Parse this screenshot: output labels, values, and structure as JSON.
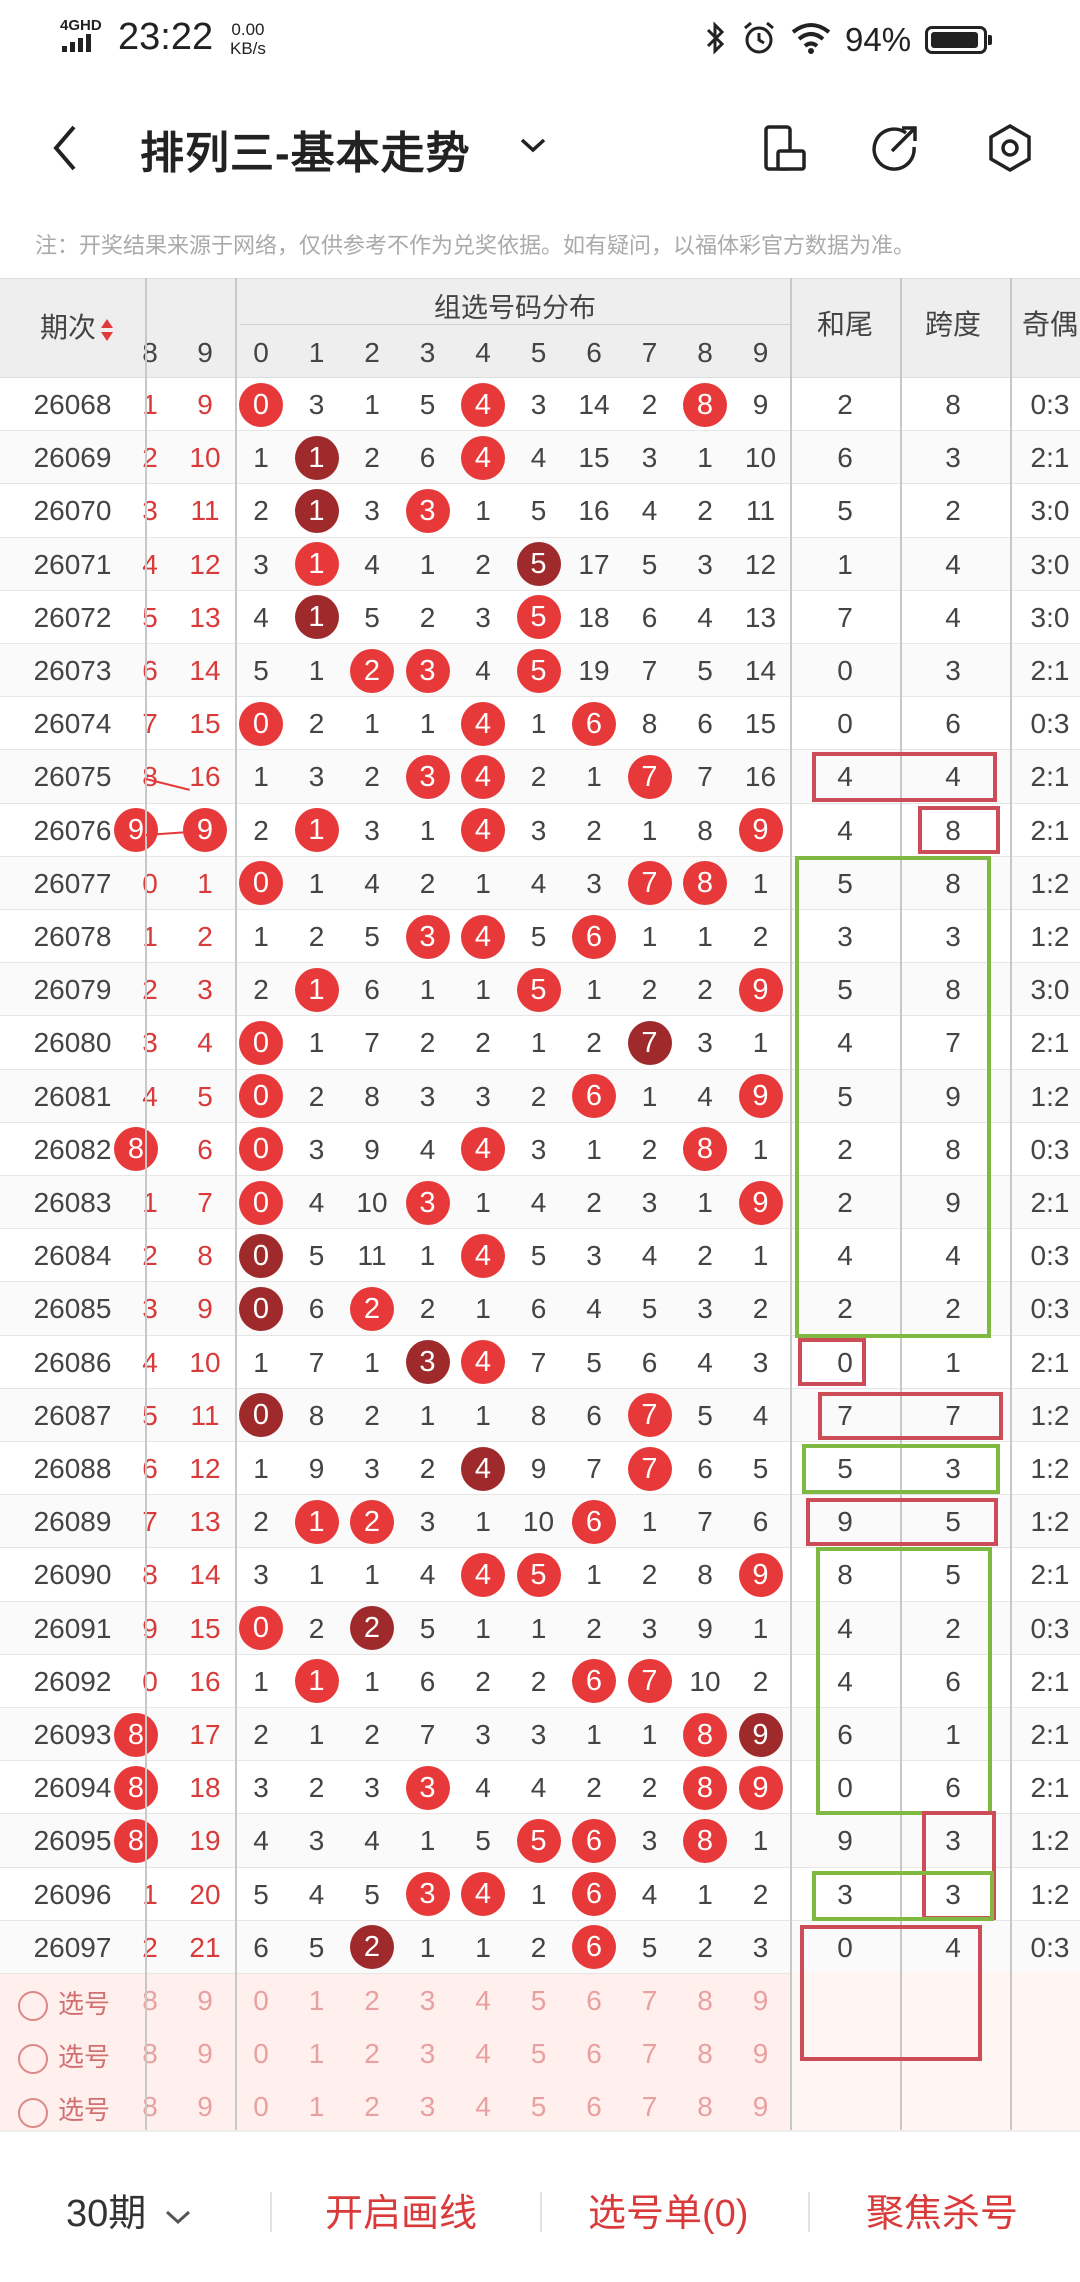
{
  "status_bar": {
    "network": "4GHD",
    "time": "23:22",
    "speed_value": "0.00",
    "speed_unit": "KB/s",
    "battery": "94%",
    "battery_level": 0.94
  },
  "header": {
    "title": "排列三-基本走势",
    "icons": [
      "back-icon",
      "chevron-down-icon",
      "phone-rotate-icon",
      "share-icon",
      "settings-icon"
    ]
  },
  "notice": "注：开奖结果来源于网络，仅供参考不作为兑奖依据。如有疑问，以福体彩官方数据为准。",
  "table": {
    "col_period": "期次",
    "group_header": "组选号码分布",
    "col_sum_tail": "和尾",
    "col_span": "跨度",
    "col_odd_even": "奇偶",
    "left_partial_headers": [
      "8",
      "9"
    ],
    "digits": [
      "0",
      "1",
      "2",
      "3",
      "4",
      "5",
      "6",
      "7",
      "8",
      "9"
    ],
    "rows": [
      {
        "p": "26068",
        "l": [
          "1",
          "9"
        ],
        "d": [
          "0",
          "3",
          "1",
          "5",
          "4",
          "3",
          "14",
          "2",
          "8",
          "9"
        ],
        "hit": [
          0,
          4,
          8
        ],
        "dark": [],
        "s": "2",
        "k": "8",
        "o": "0:3"
      },
      {
        "p": "26069",
        "l": [
          "2",
          "10"
        ],
        "d": [
          "1",
          "1",
          "2",
          "6",
          "4",
          "4",
          "15",
          "3",
          "1",
          "10"
        ],
        "hit": [
          1,
          4
        ],
        "dark": [
          1
        ],
        "s": "6",
        "k": "3",
        "o": "2:1"
      },
      {
        "p": "26070",
        "l": [
          "3",
          "11"
        ],
        "d": [
          "2",
          "1",
          "3",
          "3",
          "1",
          "5",
          "16",
          "4",
          "2",
          "11"
        ],
        "hit": [
          1,
          3
        ],
        "dark": [
          1
        ],
        "s": "5",
        "k": "2",
        "o": "3:0"
      },
      {
        "p": "26071",
        "l": [
          "4",
          "12"
        ],
        "d": [
          "3",
          "1",
          "4",
          "1",
          "2",
          "5",
          "17",
          "5",
          "3",
          "12"
        ],
        "hit": [
          1,
          5
        ],
        "dark": [
          5
        ],
        "s": "1",
        "k": "4",
        "o": "3:0"
      },
      {
        "p": "26072",
        "l": [
          "5",
          "13"
        ],
        "d": [
          "4",
          "1",
          "5",
          "2",
          "3",
          "5",
          "18",
          "6",
          "4",
          "13"
        ],
        "hit": [
          1,
          5
        ],
        "dark": [
          1
        ],
        "s": "7",
        "k": "4",
        "o": "3:0"
      },
      {
        "p": "26073",
        "l": [
          "6",
          "14"
        ],
        "d": [
          "5",
          "1",
          "2",
          "3",
          "4",
          "5",
          "19",
          "7",
          "5",
          "14"
        ],
        "hit": [
          2,
          3,
          5
        ],
        "dark": [],
        "s": "0",
        "k": "3",
        "o": "2:1"
      },
      {
        "p": "26074",
        "l": [
          "7",
          "15"
        ],
        "d": [
          "0",
          "2",
          "1",
          "1",
          "4",
          "1",
          "6",
          "8",
          "6",
          "15"
        ],
        "hit": [
          0,
          4,
          6
        ],
        "dark": [],
        "s": "0",
        "k": "6",
        "o": "0:3"
      },
      {
        "p": "26075",
        "l": [
          "8",
          "16"
        ],
        "d": [
          "1",
          "3",
          "2",
          "3",
          "4",
          "2",
          "1",
          "7",
          "7",
          "16"
        ],
        "hit": [
          3,
          4,
          7
        ],
        "dark": [],
        "s": "4",
        "k": "4",
        "o": "2:1"
      },
      {
        "p": "26076",
        "l": [
          "9",
          "9"
        ],
        "d": [
          "2",
          "1",
          "3",
          "1",
          "4",
          "3",
          "2",
          "1",
          "8",
          "9"
        ],
        "hit": [
          1,
          4,
          9
        ],
        "dark": [],
        "s": "4",
        "k": "8",
        "o": "2:1",
        "lball": true
      },
      {
        "p": "26077",
        "l": [
          "0",
          "1"
        ],
        "d": [
          "0",
          "1",
          "4",
          "2",
          "1",
          "4",
          "3",
          "7",
          "8",
          "1"
        ],
        "hit": [
          0,
          7,
          8
        ],
        "dark": [],
        "s": "5",
        "k": "8",
        "o": "1:2"
      },
      {
        "p": "26078",
        "l": [
          "1",
          "2"
        ],
        "d": [
          "1",
          "2",
          "5",
          "3",
          "4",
          "5",
          "6",
          "1",
          "1",
          "2"
        ],
        "hit": [
          3,
          4,
          6
        ],
        "dark": [],
        "s": "3",
        "k": "3",
        "o": "1:2"
      },
      {
        "p": "26079",
        "l": [
          "2",
          "3"
        ],
        "d": [
          "2",
          "1",
          "6",
          "1",
          "1",
          "5",
          "1",
          "2",
          "2",
          "9"
        ],
        "hit": [
          1,
          5,
          9
        ],
        "dark": [],
        "s": "5",
        "k": "8",
        "o": "3:0"
      },
      {
        "p": "26080",
        "l": [
          "3",
          "4"
        ],
        "d": [
          "0",
          "1",
          "7",
          "2",
          "2",
          "1",
          "2",
          "7",
          "3",
          "1"
        ],
        "hit": [
          0,
          7
        ],
        "dark": [
          7
        ],
        "s": "4",
        "k": "7",
        "o": "2:1"
      },
      {
        "p": "26081",
        "l": [
          "4",
          "5"
        ],
        "d": [
          "0",
          "2",
          "8",
          "3",
          "3",
          "2",
          "6",
          "1",
          "4",
          "9"
        ],
        "hit": [
          0,
          6,
          9
        ],
        "dark": [],
        "s": "5",
        "k": "9",
        "o": "1:2"
      },
      {
        "p": "26082",
        "l": [
          "8",
          "6"
        ],
        "d": [
          "0",
          "3",
          "9",
          "4",
          "4",
          "3",
          "1",
          "2",
          "8",
          "1"
        ],
        "hit": [
          0,
          4,
          8
        ],
        "dark": [],
        "s": "2",
        "k": "8",
        "o": "0:3",
        "lball": true
      },
      {
        "p": "26083",
        "l": [
          "1",
          "7"
        ],
        "d": [
          "0",
          "4",
          "10",
          "3",
          "1",
          "4",
          "2",
          "3",
          "1",
          "9"
        ],
        "hit": [
          0,
          3,
          9
        ],
        "dark": [],
        "s": "2",
        "k": "9",
        "o": "2:1"
      },
      {
        "p": "26084",
        "l": [
          "2",
          "8"
        ],
        "d": [
          "0",
          "5",
          "11",
          "1",
          "4",
          "5",
          "3",
          "4",
          "2",
          "1"
        ],
        "hit": [
          0,
          4
        ],
        "dark": [
          0
        ],
        "s": "4",
        "k": "4",
        "o": "0:3"
      },
      {
        "p": "26085",
        "l": [
          "3",
          "9"
        ],
        "d": [
          "0",
          "6",
          "2",
          "2",
          "1",
          "6",
          "4",
          "5",
          "3",
          "2"
        ],
        "hit": [
          0,
          2
        ],
        "dark": [
          0
        ],
        "s": "2",
        "k": "2",
        "o": "0:3"
      },
      {
        "p": "26086",
        "l": [
          "4",
          "10"
        ],
        "d": [
          "1",
          "7",
          "1",
          "3",
          "4",
          "7",
          "5",
          "6",
          "4",
          "3"
        ],
        "hit": [
          3,
          4
        ],
        "dark": [
          3
        ],
        "s": "0",
        "k": "1",
        "o": "2:1"
      },
      {
        "p": "26087",
        "l": [
          "5",
          "11"
        ],
        "d": [
          "0",
          "8",
          "2",
          "1",
          "1",
          "8",
          "6",
          "7",
          "5",
          "4"
        ],
        "hit": [
          0,
          7
        ],
        "dark": [
          0
        ],
        "s": "7",
        "k": "7",
        "o": "1:2"
      },
      {
        "p": "26088",
        "l": [
          "6",
          "12"
        ],
        "d": [
          "1",
          "9",
          "3",
          "2",
          "4",
          "9",
          "7",
          "7",
          "6",
          "5"
        ],
        "hit": [
          4,
          7
        ],
        "dark": [
          4
        ],
        "s": "5",
        "k": "3",
        "o": "1:2"
      },
      {
        "p": "26089",
        "l": [
          "7",
          "13"
        ],
        "d": [
          "2",
          "1",
          "2",
          "3",
          "1",
          "10",
          "6",
          "1",
          "7",
          "6"
        ],
        "hit": [
          1,
          2,
          6
        ],
        "dark": [],
        "s": "9",
        "k": "5",
        "o": "1:2"
      },
      {
        "p": "26090",
        "l": [
          "8",
          "14"
        ],
        "d": [
          "3",
          "1",
          "1",
          "4",
          "4",
          "5",
          "1",
          "2",
          "8",
          "9"
        ],
        "hit": [
          4,
          5,
          9
        ],
        "dark": [],
        "s": "8",
        "k": "5",
        "o": "2:1"
      },
      {
        "p": "26091",
        "l": [
          "9",
          "15"
        ],
        "d": [
          "0",
          "2",
          "2",
          "5",
          "1",
          "1",
          "2",
          "3",
          "9",
          "1"
        ],
        "hit": [
          0,
          2
        ],
        "dark": [
          2
        ],
        "s": "4",
        "k": "2",
        "o": "0:3"
      },
      {
        "p": "26092",
        "l": [
          "0",
          "16"
        ],
        "d": [
          "1",
          "1",
          "1",
          "6",
          "2",
          "2",
          "6",
          "7",
          "10",
          "2"
        ],
        "hit": [
          1,
          6,
          7
        ],
        "dark": [],
        "s": "4",
        "k": "6",
        "o": "2:1"
      },
      {
        "p": "26093",
        "l": [
          "8",
          "17"
        ],
        "d": [
          "2",
          "1",
          "2",
          "7",
          "3",
          "3",
          "1",
          "1",
          "8",
          "9"
        ],
        "hit": [
          8,
          9
        ],
        "dark": [
          9
        ],
        "s": "6",
        "k": "1",
        "o": "2:1",
        "lball": true
      },
      {
        "p": "26094",
        "l": [
          "8",
          "18"
        ],
        "d": [
          "3",
          "2",
          "3",
          "3",
          "4",
          "4",
          "2",
          "2",
          "8",
          "9"
        ],
        "hit": [
          3,
          8,
          9
        ],
        "dark": [],
        "s": "0",
        "k": "6",
        "o": "2:1",
        "lball": true
      },
      {
        "p": "26095",
        "l": [
          "8",
          "19"
        ],
        "d": [
          "4",
          "3",
          "4",
          "1",
          "5",
          "5",
          "6",
          "3",
          "8",
          "1"
        ],
        "hit": [
          5,
          6,
          8
        ],
        "dark": [],
        "s": "9",
        "k": "3",
        "o": "1:2",
        "lball": true
      },
      {
        "p": "26096",
        "l": [
          "1",
          "20"
        ],
        "d": [
          "5",
          "4",
          "5",
          "3",
          "4",
          "1",
          "6",
          "4",
          "1",
          "2"
        ],
        "hit": [
          3,
          4,
          6
        ],
        "dark": [],
        "s": "3",
        "k": "3",
        "o": "1:2"
      },
      {
        "p": "26097",
        "l": [
          "2",
          "21"
        ],
        "d": [
          "6",
          "5",
          "2",
          "1",
          "1",
          "2",
          "6",
          "5",
          "2",
          "3"
        ],
        "hit": [
          2,
          6
        ],
        "dark": [
          2
        ],
        "s": "0",
        "k": "4",
        "o": "0:3"
      }
    ],
    "select_label": "选号",
    "select_left": [
      "8",
      "9"
    ]
  },
  "bottom_bar": {
    "periods": "30期",
    "draw_lines": "开启画线",
    "selection_list": "选号单(0)",
    "focus_kill": "聚焦杀号"
  },
  "colors": {
    "red": "#e8393a",
    "dark_red": "#9e2a2b",
    "box_red": "#cc4d58",
    "box_green": "#7fb942",
    "accent_text": "#d93a3a"
  }
}
